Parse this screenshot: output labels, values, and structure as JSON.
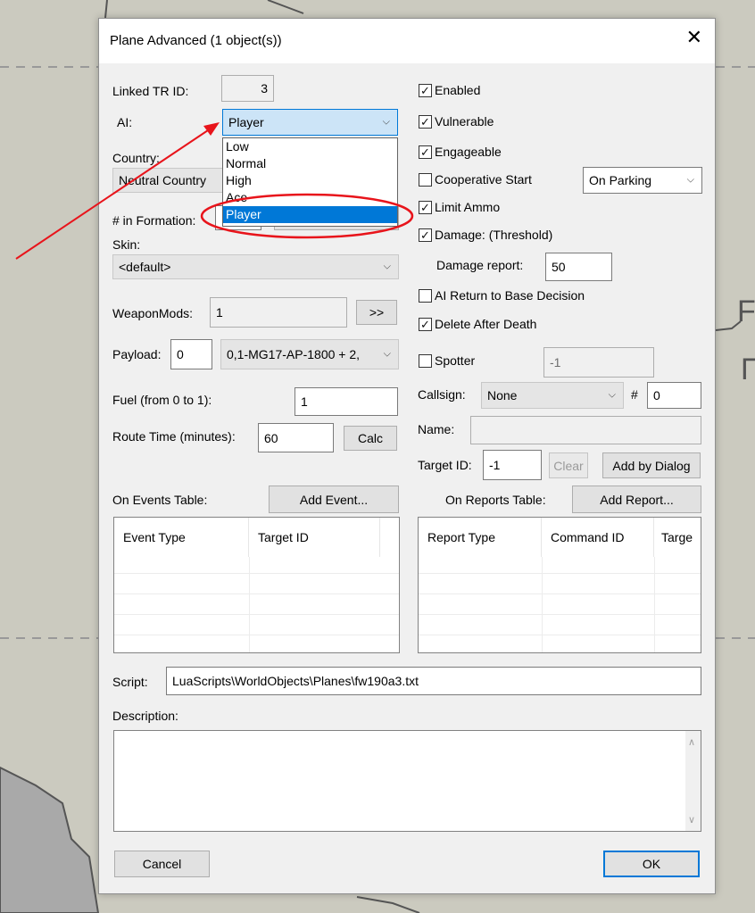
{
  "dialog": {
    "title": "Plane Advanced (1 object(s))",
    "close_glyph": "✕"
  },
  "left": {
    "linked_tr_label": "Linked TR ID:",
    "linked_tr_value": "3",
    "ai_label": "AI:",
    "ai_value": "Player",
    "ai_options": [
      "Low",
      "Normal",
      "High",
      "Ace",
      "Player"
    ],
    "ai_selected_index": 4,
    "country_label": "Country:",
    "country_value": "Neutral Country",
    "formation_label": "# in Formation:",
    "skin_label": "Skin:",
    "skin_value": "<default>",
    "weaponmods_label": "WeaponMods:",
    "weaponmods_value": "1",
    "weaponmods_button": ">>",
    "payload_label": "Payload:",
    "payload_value": "0",
    "payload_combo": "0,1-MG17-AP-1800 + 2,",
    "fuel_label": "Fuel (from 0 to 1):",
    "fuel_value": "1",
    "route_label": "Route Time (minutes):",
    "route_value": "60",
    "calc_button": "Calc"
  },
  "right": {
    "enabled": {
      "label": "Enabled",
      "checked": true
    },
    "vulnerable": {
      "label": "Vulnerable",
      "checked": true
    },
    "engageable": {
      "label": "Engageable",
      "checked": true
    },
    "cooperative": {
      "label": "Cooperative Start",
      "checked": false
    },
    "start_combo": "On Parking",
    "limit_ammo": {
      "label": "Limit Ammo",
      "checked": true
    },
    "damage": {
      "label": "Damage: (Threshold)",
      "checked": true
    },
    "damage_report_label": "Damage report:",
    "damage_report_value": "50",
    "ai_return": {
      "label": "AI Return to Base Decision",
      "checked": false
    },
    "delete_after": {
      "label": "Delete After Death",
      "checked": true
    },
    "spotter": {
      "label": "Spotter",
      "checked": false
    },
    "spotter_value": "-1",
    "callsign_label": "Callsign:",
    "callsign_value": "None",
    "hash_label": "#",
    "callsign_number": "0",
    "name_label": "Name:",
    "name_value": "",
    "target_label": "Target ID:",
    "target_value": "-1",
    "clear_button": "Clear",
    "add_dialog_button": "Add by Dialog"
  },
  "events": {
    "label": "On Events Table:",
    "add_button": "Add Event...",
    "columns": [
      "Event Type",
      "Target ID"
    ]
  },
  "reports": {
    "label": "On Reports Table:",
    "add_button": "Add Report...",
    "columns": [
      "Report Type",
      "Command ID",
      "Targe"
    ]
  },
  "script": {
    "label": "Script:",
    "value": "LuaScripts\\WorldObjects\\Planes\\fw190a3.txt"
  },
  "description": {
    "label": "Description:",
    "value": ""
  },
  "footer": {
    "cancel": "Cancel",
    "ok": "OK"
  },
  "background_map": {
    "letters": [
      "F",
      "П"
    ]
  },
  "colors": {
    "highlight": "#0078d7",
    "annotation": "#e8141b"
  }
}
